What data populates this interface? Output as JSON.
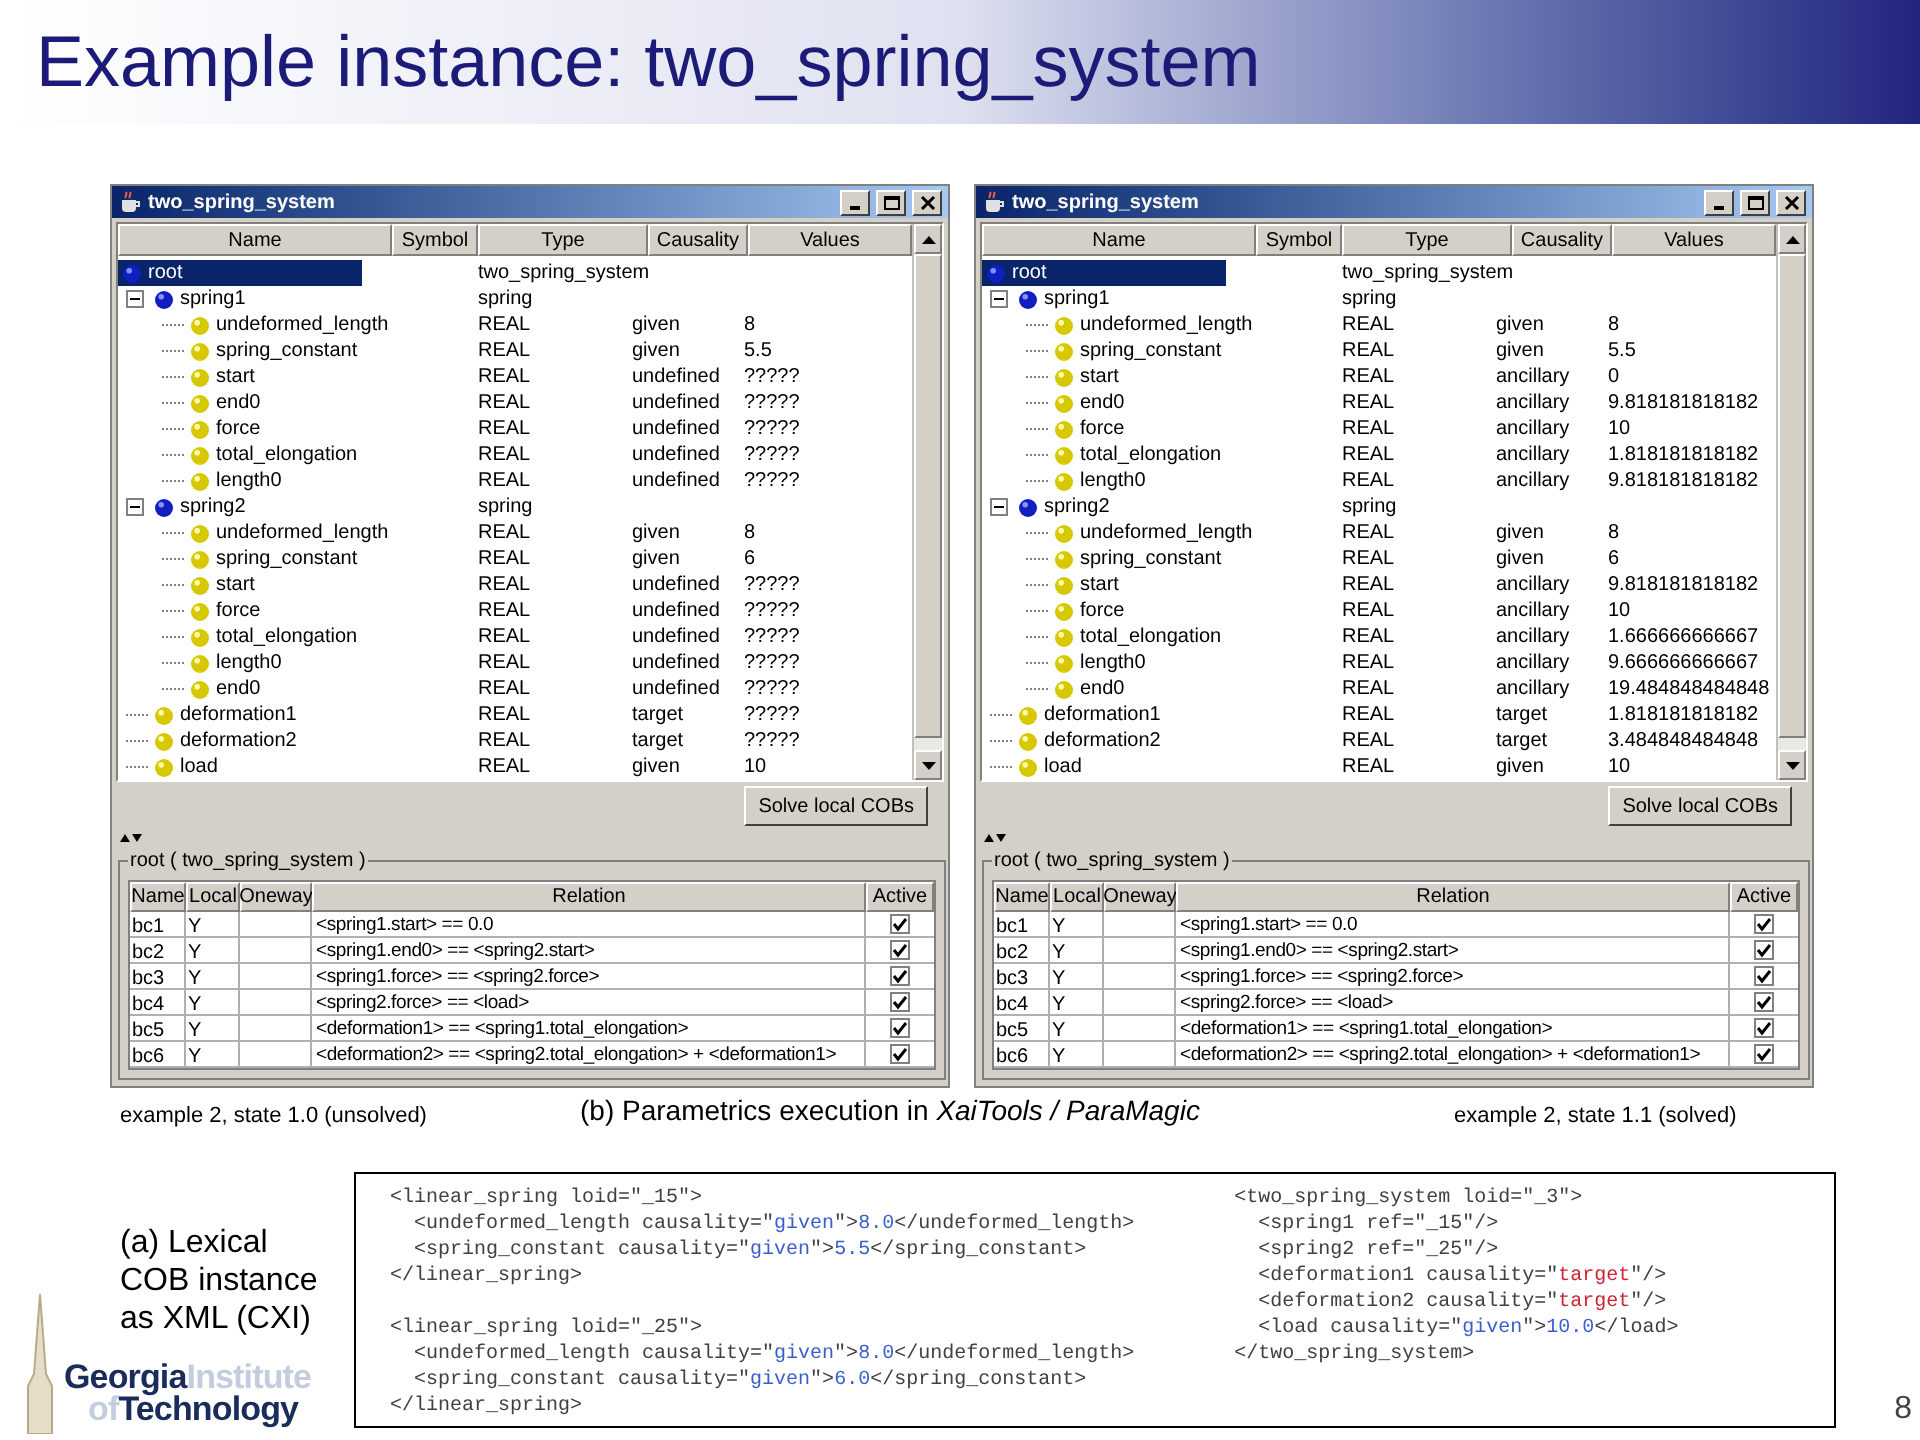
{
  "slide_title": "Example instance: two_spring_system",
  "windows": [
    {
      "title": "two_spring_system",
      "columns": [
        "Name",
        "Symbol",
        "Type",
        "Causality",
        "Values"
      ],
      "tree": {
        "name": "root",
        "type": "two_spring_system",
        "selected": true,
        "children": [
          {
            "name": "spring1",
            "type": "spring",
            "selected": false,
            "expanded": true,
            "children": [
              {
                "name": "undeformed_length",
                "type": "REAL",
                "causality": "given",
                "value": "8",
                "selected": false
              },
              {
                "name": "spring_constant",
                "type": "REAL",
                "causality": "given",
                "value": "5.5",
                "selected": false
              },
              {
                "name": "start",
                "type": "REAL",
                "causality": "undefined",
                "value": "?????",
                "selected": false
              },
              {
                "name": "end0",
                "type": "REAL",
                "causality": "undefined",
                "value": "?????",
                "selected": false
              },
              {
                "name": "force",
                "type": "REAL",
                "causality": "undefined",
                "value": "?????",
                "selected": false
              },
              {
                "name": "total_elongation",
                "type": "REAL",
                "causality": "undefined",
                "value": "?????",
                "selected": false
              },
              {
                "name": "length0",
                "type": "REAL",
                "causality": "undefined",
                "value": "?????",
                "selected": false
              }
            ]
          },
          {
            "name": "spring2",
            "type": "spring",
            "selected": false,
            "expanded": true,
            "children": [
              {
                "name": "undeformed_length",
                "type": "REAL",
                "causality": "given",
                "value": "8",
                "selected": false
              },
              {
                "name": "spring_constant",
                "type": "REAL",
                "causality": "given",
                "value": "6",
                "selected": false
              },
              {
                "name": "start",
                "type": "REAL",
                "causality": "undefined",
                "value": "?????",
                "selected": false
              },
              {
                "name": "force",
                "type": "REAL",
                "causality": "undefined",
                "value": "?????",
                "selected": false
              },
              {
                "name": "total_elongation",
                "type": "REAL",
                "causality": "undefined",
                "value": "?????",
                "selected": false
              },
              {
                "name": "length0",
                "type": "REAL",
                "causality": "undefined",
                "value": "?????",
                "selected": false
              },
              {
                "name": "end0",
                "type": "REAL",
                "causality": "undefined",
                "value": "?????",
                "selected": false
              }
            ]
          },
          {
            "name": "deformation1",
            "type": "REAL",
            "causality": "target",
            "value": "?????",
            "selected": false
          },
          {
            "name": "deformation2",
            "type": "REAL",
            "causality": "target",
            "value": "?????",
            "selected": false
          },
          {
            "name": "load",
            "type": "REAL",
            "causality": "given",
            "value": "10",
            "selected": false
          }
        ]
      },
      "button": "Solve local COBs",
      "group_title": "root ( two_spring_system )",
      "relation_columns": [
        "Name",
        "Local",
        "Oneway",
        "Relation",
        "Active"
      ],
      "relations": [
        {
          "name": "bc1",
          "local": "Y",
          "relation": "<spring1.start> == 0.0",
          "active": true
        },
        {
          "name": "bc2",
          "local": "Y",
          "relation": "<spring1.end0> == <spring2.start>",
          "active": true
        },
        {
          "name": "bc3",
          "local": "Y",
          "relation": "<spring1.force> == <spring2.force>",
          "active": true
        },
        {
          "name": "bc4",
          "local": "Y",
          "relation": "<spring2.force> == <load>",
          "active": true
        },
        {
          "name": "bc5",
          "local": "Y",
          "relation": "<deformation1> == <spring1.total_elongation>",
          "active": true
        },
        {
          "name": "bc6",
          "local": "Y",
          "relation": "<deformation2> == <spring2.total_elongation> + <deformation1>",
          "active": true
        }
      ]
    },
    {
      "title": "two_spring_system",
      "columns": [
        "Name",
        "Symbol",
        "Type",
        "Causality",
        "Values"
      ],
      "tree": {
        "name": "root",
        "type": "two_spring_system",
        "selected": true,
        "children": [
          {
            "name": "spring1",
            "type": "spring",
            "selected": false,
            "expanded": true,
            "children": [
              {
                "name": "undeformed_length",
                "type": "REAL",
                "causality": "given",
                "value": "8",
                "selected": false
              },
              {
                "name": "spring_constant",
                "type": "REAL",
                "causality": "given",
                "value": "5.5",
                "selected": false
              },
              {
                "name": "start",
                "type": "REAL",
                "causality": "ancillary",
                "value": "0",
                "selected": false
              },
              {
                "name": "end0",
                "type": "REAL",
                "causality": "ancillary",
                "value": "9.818181818182",
                "selected": false
              },
              {
                "name": "force",
                "type": "REAL",
                "causality": "ancillary",
                "value": "10",
                "selected": false
              },
              {
                "name": "total_elongation",
                "type": "REAL",
                "causality": "ancillary",
                "value": "1.818181818182",
                "selected": false
              },
              {
                "name": "length0",
                "type": "REAL",
                "causality": "ancillary",
                "value": "9.818181818182",
                "selected": false
              }
            ]
          },
          {
            "name": "spring2",
            "type": "spring",
            "selected": false,
            "expanded": true,
            "children": [
              {
                "name": "undeformed_length",
                "type": "REAL",
                "causality": "given",
                "value": "8",
                "selected": false
              },
              {
                "name": "spring_constant",
                "type": "REAL",
                "causality": "given",
                "value": "6",
                "selected": false
              },
              {
                "name": "start",
                "type": "REAL",
                "causality": "ancillary",
                "value": "9.818181818182",
                "selected": false
              },
              {
                "name": "force",
                "type": "REAL",
                "causality": "ancillary",
                "value": "10",
                "selected": false
              },
              {
                "name": "total_elongation",
                "type": "REAL",
                "causality": "ancillary",
                "value": "1.666666666667",
                "selected": false
              },
              {
                "name": "length0",
                "type": "REAL",
                "causality": "ancillary",
                "value": "9.666666666667",
                "selected": false
              },
              {
                "name": "end0",
                "type": "REAL",
                "causality": "ancillary",
                "value": "19.484848484848",
                "selected": false
              }
            ]
          },
          {
            "name": "deformation1",
            "type": "REAL",
            "causality": "target",
            "value": "1.818181818182",
            "selected": false
          },
          {
            "name": "deformation2",
            "type": "REAL",
            "causality": "target",
            "value": "3.484848484848",
            "selected": false
          },
          {
            "name": "load",
            "type": "REAL",
            "causality": "given",
            "value": "10",
            "selected": false
          }
        ]
      },
      "button": "Solve local COBs",
      "group_title": "root ( two_spring_system )",
      "relation_columns": [
        "Name",
        "Local",
        "Oneway",
        "Relation",
        "Active"
      ],
      "relations": [
        {
          "name": "bc1",
          "local": "Y",
          "relation": "<spring1.start> == 0.0",
          "active": true
        },
        {
          "name": "bc2",
          "local": "Y",
          "relation": "<spring1.end0> == <spring2.start>",
          "active": true
        },
        {
          "name": "bc3",
          "local": "Y",
          "relation": "<spring1.force> == <spring2.force>",
          "active": true
        },
        {
          "name": "bc4",
          "local": "Y",
          "relation": "<spring2.force> == <load>",
          "active": true
        },
        {
          "name": "bc5",
          "local": "Y",
          "relation": "<deformation1> == <spring1.total_elongation>",
          "active": true
        },
        {
          "name": "bc6",
          "local": "Y",
          "relation": "<deformation2> == <spring2.total_elongation> + <deformation1>",
          "active": true
        }
      ]
    }
  ],
  "captions": {
    "left": "example 2, state 1.0 (unsolved)",
    "center": "(b) Parametrics execution in *XaiTools / ParaMagic*",
    "right": "example 2, state 1.1 (solved)"
  },
  "xml_label": "(a) Lexical COB instance as XML (CXI)",
  "xml_columns": [
    {
      "blocks": [
        [
          [
            {
              "text": "<linear_spring loid=\"_15\">"
            }
          ],
          [
            {
              "text": "  <undeformed_length causality=\""
            },
            {
              "text": "given",
              "color": "#3a5fcd"
            },
            {
              "text": "\">"
            },
            {
              "text": "8.0",
              "color": "#3a5fcd"
            },
            {
              "text": "</undeformed_length>"
            }
          ],
          [
            {
              "text": "  <spring_constant causality=\""
            },
            {
              "text": "given",
              "color": "#3a5fcd"
            },
            {
              "text": "\">"
            },
            {
              "text": "5.5",
              "color": "#3a5fcd"
            },
            {
              "text": "</spring_constant>"
            }
          ],
          [
            {
              "text": "</linear_spring>"
            }
          ]
        ],
        [
          [
            {
              "text": "<linear_spring loid=\"_25\">"
            }
          ],
          [
            {
              "text": "  <undeformed_length causality=\""
            },
            {
              "text": "given",
              "color": "#3a5fcd"
            },
            {
              "text": "\">"
            },
            {
              "text": "8.0",
              "color": "#3a5fcd"
            },
            {
              "text": "</undeformed_length>"
            }
          ],
          [
            {
              "text": "  <spring_constant causality=\""
            },
            {
              "text": "given",
              "color": "#3a5fcd"
            },
            {
              "text": "\">"
            },
            {
              "text": "6.0",
              "color": "#3a5fcd"
            },
            {
              "text": "</spring_constant>"
            }
          ],
          [
            {
              "text": "</linear_spring>"
            }
          ]
        ]
      ]
    },
    {
      "blocks": [
        [
          [
            {
              "text": "<two_spring_system loid=\"_3\">"
            }
          ],
          [
            {
              "text": "  <spring1 ref=\"_15\"/>"
            }
          ],
          [
            {
              "text": "  <spring2 ref=\"_25\"/>"
            }
          ],
          [
            {
              "text": "  <deformation1 causality=\""
            },
            {
              "text": "target",
              "color": "#cc2233"
            },
            {
              "text": "\"/>"
            }
          ],
          [
            {
              "text": "  <deformation2 causality=\""
            },
            {
              "text": "target",
              "color": "#cc2233"
            },
            {
              "text": "\"/>"
            }
          ],
          [
            {
              "text": "  <load causality=\""
            },
            {
              "text": "given",
              "color": "#3a5fcd"
            },
            {
              "text": "\">"
            },
            {
              "text": "10.0",
              "color": "#3a5fcd"
            },
            {
              "text": "</load>"
            }
          ],
          [
            {
              "text": "</two_spring_system>"
            }
          ]
        ]
      ]
    }
  ],
  "logo": [
    [
      {
        "text": "Georgia",
        "kind": "strong"
      },
      {
        "text": "Institute",
        "kind": "light"
      }
    ],
    [
      {
        "text": "of",
        "kind": "light"
      },
      {
        "text": "Technology",
        "kind": "strong"
      }
    ]
  ],
  "page_number": "8"
}
